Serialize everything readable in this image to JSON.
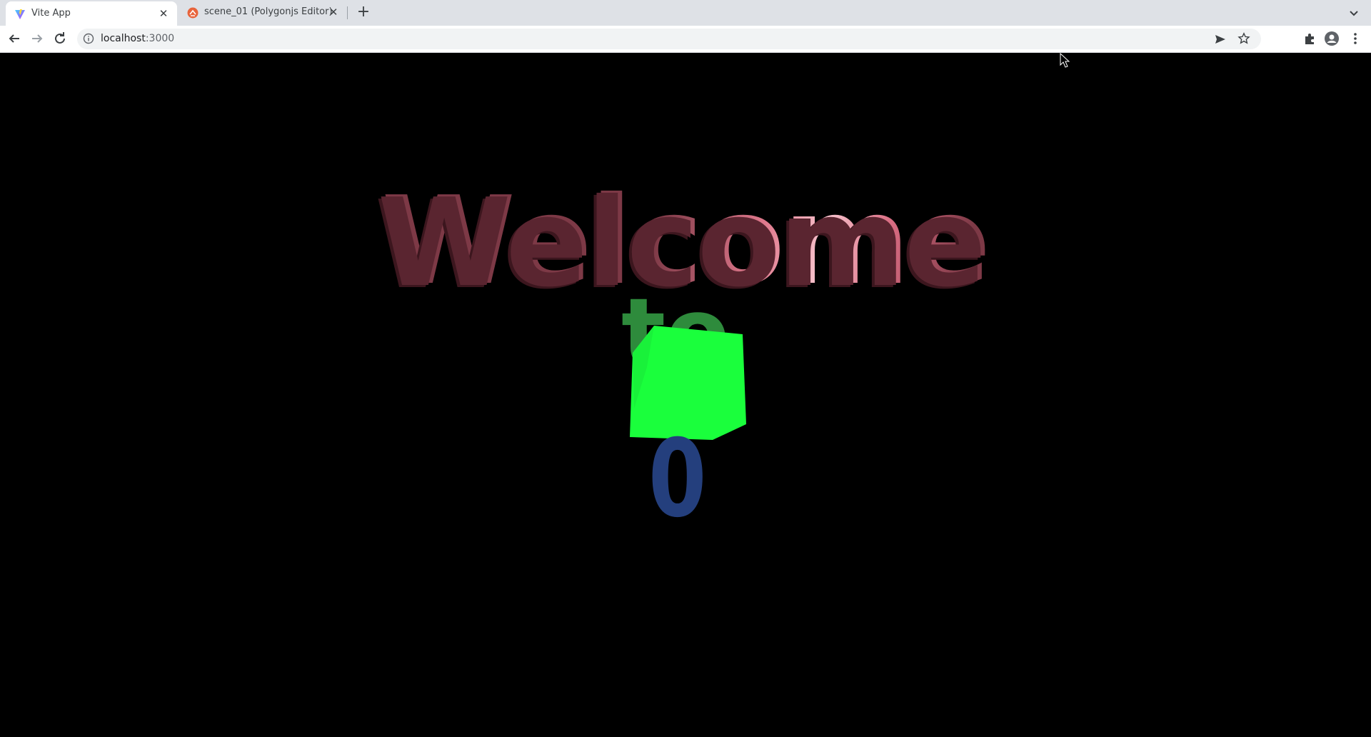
{
  "tabs": [
    {
      "title": "Vite App",
      "favicon": "vite-icon",
      "active": true,
      "close_label": "✕"
    },
    {
      "title": "scene_01 (Polygonjs Editor)",
      "favicon": "polygonjs-icon",
      "active": false,
      "close_label": "✕"
    }
  ],
  "newtab_label": "+",
  "toolbar": {
    "back": "back-arrow-icon",
    "forward": "forward-arrow-icon",
    "reload": "reload-icon",
    "url_host": "localhost",
    "url_port": ":3000"
  },
  "scene": {
    "word1": "Welcome",
    "word2": "to",
    "word3": "0",
    "colors": {
      "welcome": "#7d3946",
      "welcome_highlight": "#f7c2cc",
      "to": "#2e8b3c",
      "cube": "#1aff3c",
      "zero": "#243f7d",
      "background": "#000000"
    }
  }
}
